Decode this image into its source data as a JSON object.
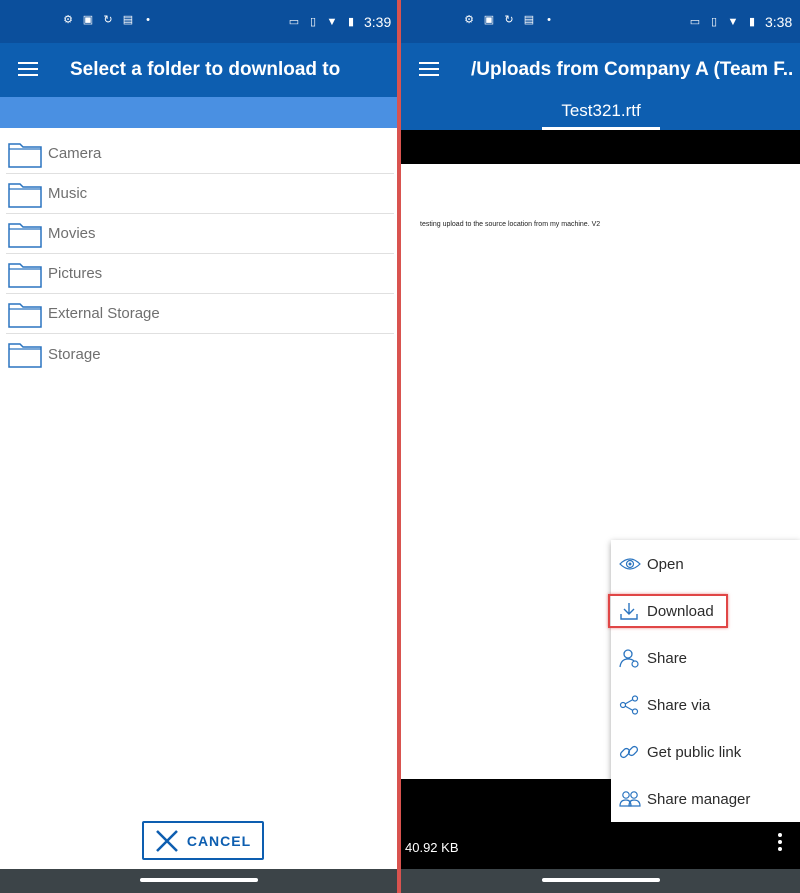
{
  "left": {
    "status": {
      "time": "3:39"
    },
    "title": "Select a folder to download to",
    "folders": [
      "Camera",
      "Music",
      "Movies",
      "Pictures",
      "External Storage",
      "Storage"
    ],
    "cancel_label": "CANCEL"
  },
  "right": {
    "status": {
      "time": "3:38"
    },
    "title": "/Uploads from Company A (Team F...",
    "tab_label": "Test321.rtf",
    "doc_text": "testing upload to the source location from my machine. V2",
    "file_size": "40.92 KB",
    "menu": [
      {
        "label": "Open",
        "icon": "eye-icon"
      },
      {
        "label": "Download",
        "icon": "download-icon"
      },
      {
        "label": "Share",
        "icon": "person-share-icon"
      },
      {
        "label": "Share via",
        "icon": "share-nodes-icon"
      },
      {
        "label": "Get public link",
        "icon": "link-icon"
      },
      {
        "label": "Share manager",
        "icon": "people-icon"
      }
    ]
  },
  "colors": {
    "statusbar": "#0b4f9c",
    "appbar": "#0d5eb0",
    "subbar": "#4a90e2",
    "highlight": "#e04646",
    "navbar": "#3c4448"
  }
}
